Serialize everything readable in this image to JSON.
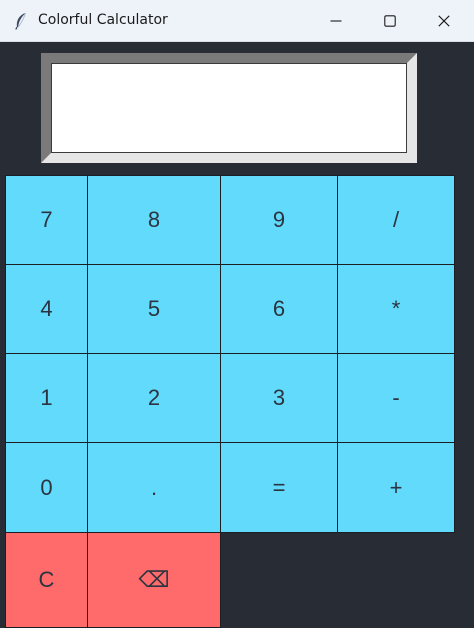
{
  "window": {
    "title": "Colorful Calculator",
    "app_icon": "feather-icon",
    "controls": [
      "minimize-icon",
      "maximize-icon",
      "close-icon"
    ]
  },
  "display": {
    "value": "",
    "placeholder": ""
  },
  "keys": {
    "row1": [
      "7",
      "8",
      "9",
      "/"
    ],
    "row2": [
      "4",
      "5",
      "6",
      "*"
    ],
    "row3": [
      "1",
      "2",
      "3",
      "-"
    ],
    "row4": [
      "0",
      ".",
      "=",
      "+"
    ],
    "row5": [
      "C",
      "⌫"
    ]
  },
  "colors": {
    "window_bg": "#282c34",
    "key_blue": "#61dafb",
    "key_red": "#ff6b6b",
    "key_text": "#2b3440"
  }
}
